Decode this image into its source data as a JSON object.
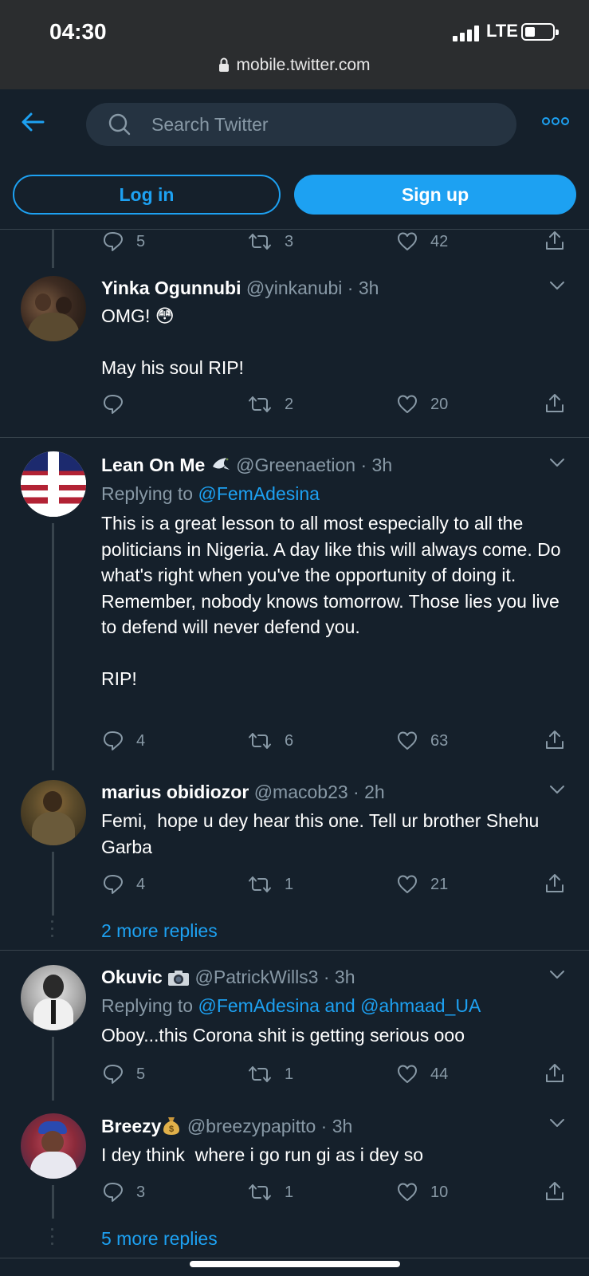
{
  "status": {
    "time": "04:30",
    "network": "LTE",
    "url": "mobile.twitter.com"
  },
  "header": {
    "search_placeholder": "Search Twitter",
    "login": "Log in",
    "signup": "Sign up"
  },
  "prev_actions": {
    "replies": "5",
    "retweets": "3",
    "likes": "42"
  },
  "tweets": [
    {
      "name": "Yinka Ogunnubi",
      "handle": "@yinkanubi",
      "time": "· 3h",
      "text": "OMG! 😳\n\nMay his soul RIP!",
      "replies": "",
      "retweets": "2",
      "likes": "20"
    },
    {
      "name": "Lean On Me",
      "handle": "@Greenaetion",
      "time": "· 3h",
      "replying_label": "Replying to",
      "replying_to": "@FemAdesina",
      "text": "This is a great lesson to all most especially to all the politicians in Nigeria. A day like this will always come. Do what's right when you've the opportunity of doing it. Remember, nobody knows tomorrow. Those lies you live to defend will never defend you.\n\nRIP!",
      "replies": "4",
      "retweets": "6",
      "likes": "63"
    },
    {
      "name": "marius obidiozor",
      "handle": "@macob23",
      "time": "· 2h",
      "text": "Femi,  hope u dey hear this one. Tell ur brother Shehu Garba",
      "replies": "4",
      "retweets": "1",
      "likes": "21"
    },
    {
      "name": "Okuvic",
      "handle": "@PatrickWills3",
      "time": "· 3h",
      "replying_label": "Replying to",
      "replying_to": "@FemAdesina and @ahmaad_UA",
      "text": "Oboy...this Corona shit is getting serious ooo",
      "replies": "5",
      "retweets": "1",
      "likes": "44"
    },
    {
      "name": "Breezy",
      "handle": "@breezypapitto",
      "time": "· 3h",
      "text": "I dey think  where i go run gi as i dey so",
      "replies": "3",
      "retweets": "1",
      "likes": "10"
    }
  ],
  "more_replies": [
    "2 more replies",
    "5 more replies"
  ],
  "icons": {
    "back": "back-arrow-icon",
    "search": "search-icon",
    "more": "more-options-icon",
    "reply": "reply-icon",
    "retweet": "retweet-icon",
    "like": "like-icon",
    "share": "share-icon",
    "caret": "chevron-down-icon"
  },
  "colors": {
    "bg": "#15202b",
    "accent": "#1da1f2",
    "muted": "#8899a6",
    "border": "#38444d"
  }
}
